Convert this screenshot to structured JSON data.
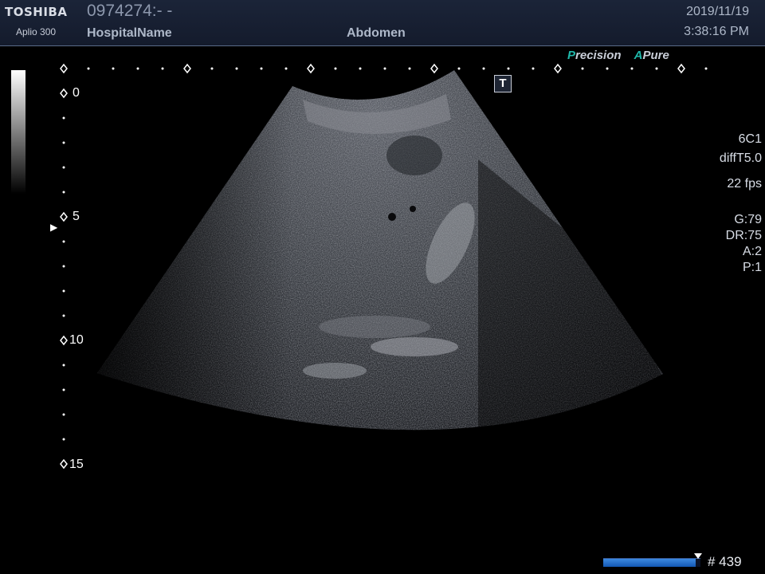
{
  "header": {
    "brand": "TOSHIBA",
    "model": "Aplio 300",
    "patient_id": "0974274:- -",
    "hospital": "HospitalName",
    "exam": "Abdomen",
    "date": "2019/11/19",
    "time": "3:38:16 PM"
  },
  "logos": {
    "precision_initial": "P",
    "precision_rest": "recision",
    "pure_initial": "A",
    "pure_rest": "Pure"
  },
  "depth_scale": [
    "0",
    "5",
    "10",
    "15"
  ],
  "t_badge": "T",
  "parameters": {
    "probe": "6C1",
    "mode": "diffT5.0",
    "frame_rate": "22 fps",
    "gain": "G:79",
    "dynamic_range": "DR:75",
    "a": "A:2",
    "p": "P:1"
  },
  "cine": {
    "frame_count": "# 439",
    "progress": 0.95
  },
  "colors": {
    "header_bg": "#1b2438",
    "accent_teal": "#1fb7a9",
    "progress_blue": "#1f6fd0"
  }
}
